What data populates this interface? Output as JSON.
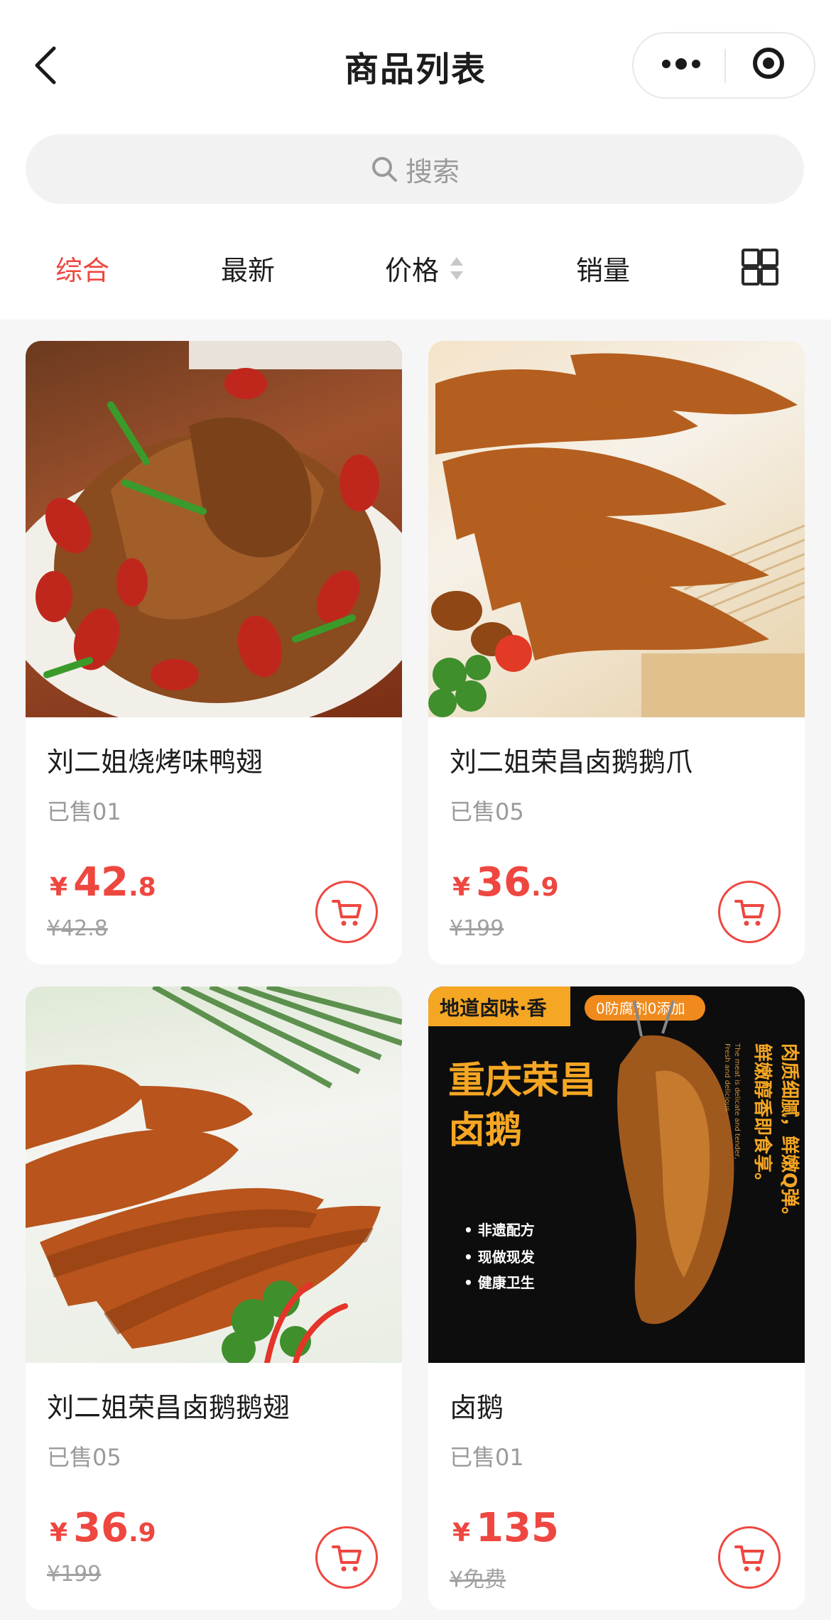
{
  "header": {
    "title": "商品列表"
  },
  "search": {
    "placeholder": "搜索"
  },
  "tabs": [
    {
      "label": "综合",
      "active": true
    },
    {
      "label": "最新"
    },
    {
      "label": "价格"
    },
    {
      "label": "销量"
    }
  ],
  "colors": {
    "accent": "#ee4740"
  },
  "products": [
    {
      "name": "刘二姐烧烤味鸭翅",
      "sold": "已售01",
      "price_currency": "¥",
      "price_int": "42",
      "price_dec": ".8",
      "original_price": "¥42.8"
    },
    {
      "name": "刘二姐荣昌卤鹅鹅爪",
      "sold": "已售05",
      "price_currency": "¥",
      "price_int": "36",
      "price_dec": ".9",
      "original_price": "¥199"
    },
    {
      "name": "刘二姐荣昌卤鹅鹅翅",
      "sold": "已售05",
      "price_currency": "¥",
      "price_int": "36",
      "price_dec": ".9",
      "original_price": "¥199"
    },
    {
      "name": "卤鹅",
      "sold": "已售01",
      "price_currency": "¥",
      "price_int": "135",
      "price_dec": "",
      "original_price": "¥免费",
      "image_text": {
        "banner": "地道卤味·香",
        "badge": "0防腐剂0添加",
        "headline1": "重庆荣昌",
        "headline2": "卤鹅",
        "bullets": [
          "• 非遗配方",
          "• 现做现发",
          "• 健康卫生"
        ],
        "vertical1": "肉质细腻，鲜嫩Q弹。",
        "vertical2": "鲜嫩醇香即食享。",
        "small1": "The meat is delicate and tender,",
        "small2": "Fresh and delicious"
      }
    }
  ]
}
